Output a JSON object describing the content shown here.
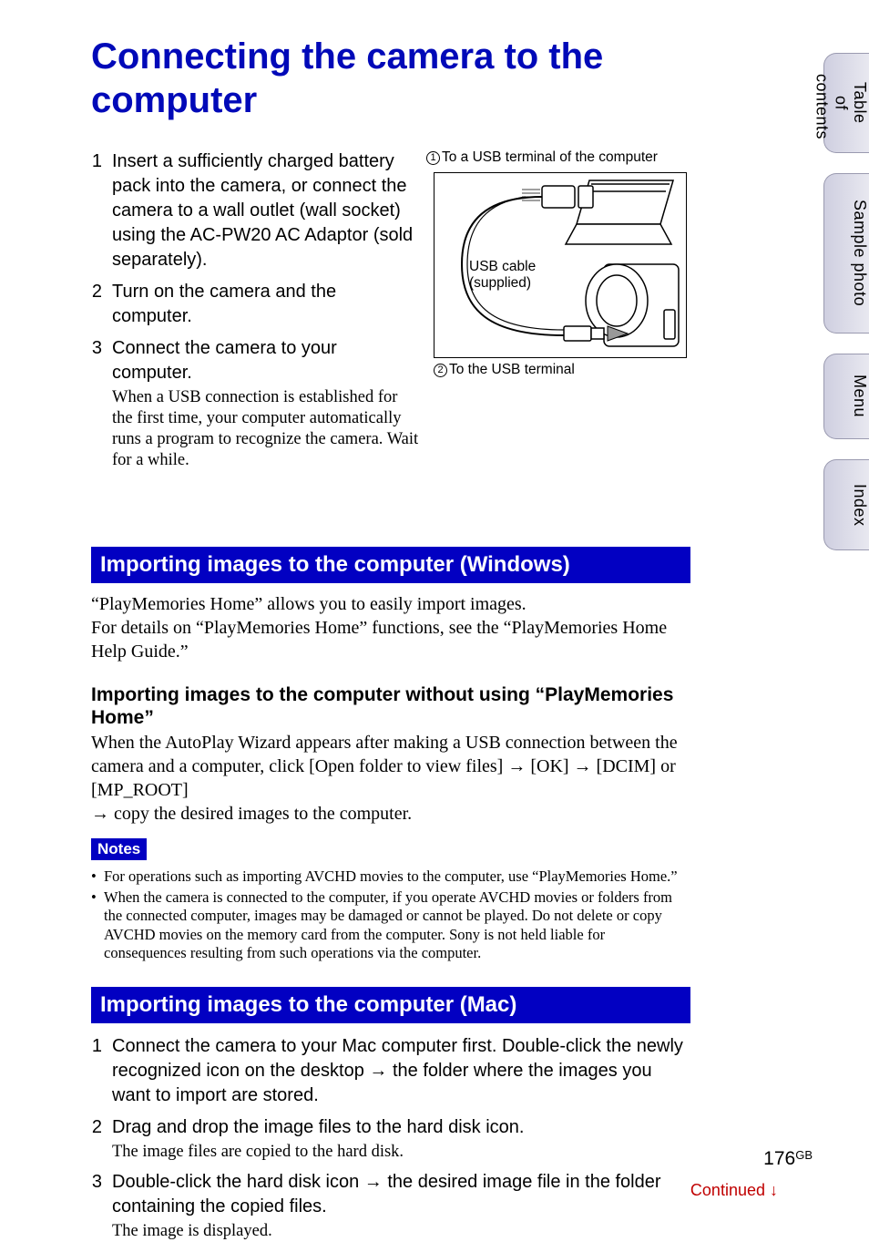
{
  "title": "Connecting the camera to the computer",
  "steps": [
    {
      "num": "1",
      "text": "Insert a sufficiently charged battery pack into the camera, or connect the camera to a wall outlet (wall socket) using the AC-PW20 AC Adaptor (sold separately)."
    },
    {
      "num": "2",
      "text": "Turn on the camera and the computer."
    },
    {
      "num": "3",
      "text": "Connect the camera to your computer.",
      "sub": "When a USB connection is established for the first time, your computer automatically runs a program to recognize the camera. Wait for a while."
    }
  ],
  "callouts": {
    "c1_num": "1",
    "c1_text": "To a USB terminal of the computer",
    "usb_label_1": "USB cable",
    "usb_label_2": "(supplied)",
    "c2_num": "2",
    "c2_text": "To the USB terminal"
  },
  "section1": {
    "heading": "Importing images to the computer (Windows)",
    "body": "“PlayMemories Home” allows you to easily import images.\nFor details on “PlayMemories Home” functions, see the “PlayMemories Home Help Guide.”",
    "subhead": "Importing images to the computer without using “PlayMemories Home”",
    "subbody_pre": "When the AutoPlay Wizard appears after making a USB connection between the camera and a computer, click [Open folder to view files] ",
    "arrow": "→",
    "subbody_mid1": " [OK] ",
    "subbody_mid2": " [DCIM] or [MP_ROOT] ",
    "subbody_post": " copy the desired images to the computer.",
    "notes_label": "Notes",
    "notes": [
      "For operations such as importing AVCHD movies to the computer, use “PlayMemories Home.”",
      "When the camera is connected to the computer, if you operate AVCHD movies or folders from the connected computer, images may be damaged or cannot be played. Do not delete or copy AVCHD movies on the memory card from the computer. Sony is not held liable for consequences resulting from such operations via the computer."
    ]
  },
  "section2": {
    "heading": "Importing images to the computer (Mac)",
    "steps": [
      {
        "num": "1",
        "pre": "Connect the camera to your Mac computer first. Double-click the newly recognized icon on the desktop ",
        "arrow": "→",
        "post": " the folder where the images you want to import are stored."
      },
      {
        "num": "2",
        "text": "Drag and drop the image files to the hard disk icon.",
        "sub": "The image files are copied to the hard disk."
      },
      {
        "num": "3",
        "pre": "Double-click the hard disk icon ",
        "arrow": "→",
        "post": " the desired image file in the folder containing the copied files.",
        "sub": "The image is displayed."
      }
    ]
  },
  "sidebar": [
    "Table of contents",
    "Sample photo",
    "Menu",
    "Index"
  ],
  "page_number": "176",
  "page_suffix": "GB",
  "continued": "Continued ",
  "down_arrow": "↓"
}
